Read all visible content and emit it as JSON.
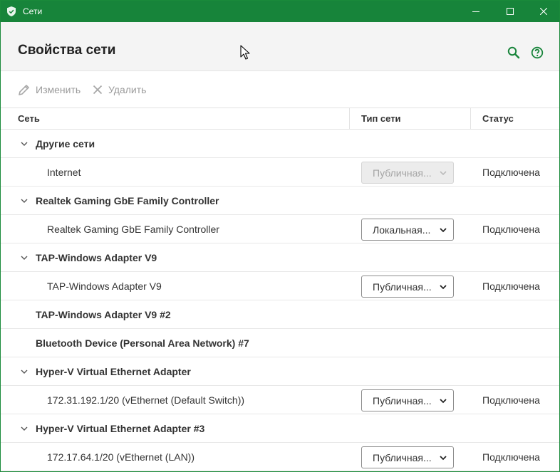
{
  "window": {
    "title": "Сети",
    "accent": "#17843a"
  },
  "header": {
    "title": "Свойства сети",
    "search_icon": "search-icon",
    "help_icon": "help-icon"
  },
  "toolbar": {
    "edit_label": "Изменить",
    "delete_label": "Удалить"
  },
  "columns": {
    "network": "Сеть",
    "type": "Тип сети",
    "status": "Статус"
  },
  "rows": [
    {
      "name": "Другие сети"
    },
    {
      "name": "Internet",
      "type": "Публичная...",
      "status": "Подключена"
    },
    {
      "name": "Realtek Gaming GbE Family Controller"
    },
    {
      "name": "Realtek Gaming GbE Family Controller",
      "type": "Локальная...",
      "status": "Подключена"
    },
    {
      "name": "TAP-Windows Adapter V9"
    },
    {
      "name": "TAP-Windows Adapter V9",
      "type": "Публичная...",
      "status": "Подключена"
    },
    {
      "name": "TAP-Windows Adapter V9 #2"
    },
    {
      "name": "Bluetooth Device (Personal Area Network) #7"
    },
    {
      "name": "Hyper-V Virtual Ethernet Adapter"
    },
    {
      "name": "172.31.192.1/20 (vEthernet (Default Switch))",
      "type": "Публичная...",
      "status": "Подключена"
    },
    {
      "name": "Hyper-V Virtual Ethernet Adapter #3"
    },
    {
      "name": "172.17.64.1/20 (vEthernet (LAN))",
      "type": "Публичная...",
      "status": "Подключена"
    }
  ]
}
